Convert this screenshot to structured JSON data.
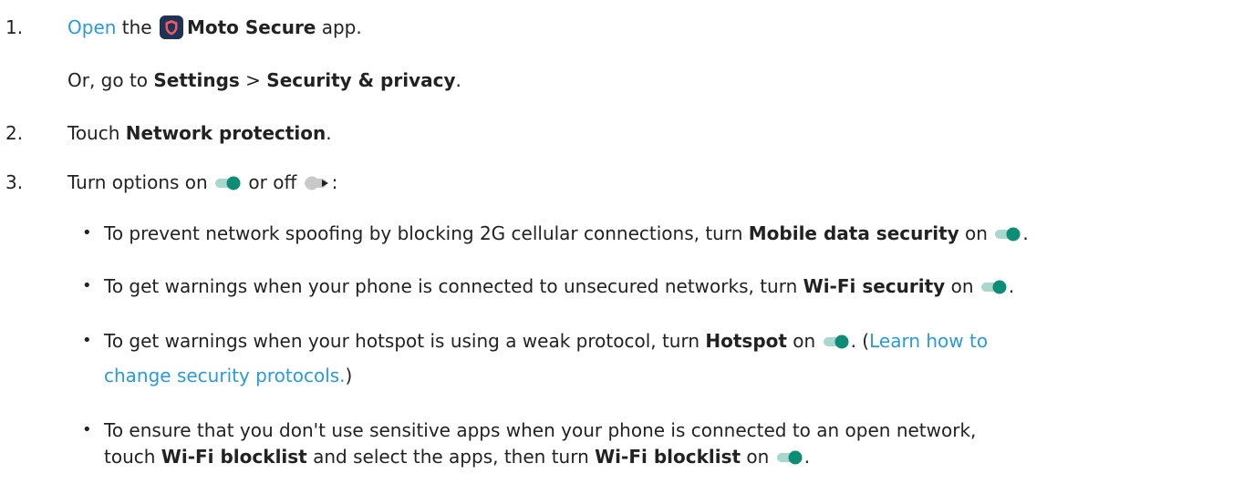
{
  "colors": {
    "link": "#2a9bd8",
    "toggle_on_track": "#a7d7cd",
    "toggle_on_knob": "#0e8c76",
    "toggle_off_track": "#c9c9c9",
    "toggle_off_knob": "#222222",
    "app_icon_bg": "#1d3357",
    "app_icon_shield": "#f05a63"
  },
  "icons": {
    "app": "moto-secure-shield-icon",
    "toggle_on": "toggle-on-icon",
    "toggle_off": "toggle-off-icon"
  },
  "step1": {
    "number": "1.",
    "link_open": "Open",
    "text_the": " the ",
    "app_name": "Moto Secure",
    "text_app": " app.",
    "alt_prefix": "Or, go to ",
    "settings": "Settings",
    "sep": " > ",
    "security_privacy": "Security & privacy",
    "period": "."
  },
  "step2": {
    "number": "2.",
    "prefix": "Touch ",
    "bold": "Network protection",
    "period": "."
  },
  "step3": {
    "number": "3.",
    "text_a": "Turn options on ",
    "text_b": " or off ",
    "colon": ":"
  },
  "bullets": {
    "dot": "•",
    "b1": {
      "prefix": "To prevent network spoofing by blocking 2G cellular connections, turn ",
      "bold": "Mobile data security",
      "on": " on ",
      "period": "."
    },
    "b2": {
      "prefix": "To get warnings when your phone is connected to unsecured networks, turn ",
      "bold": "Wi-Fi security",
      "on": " on ",
      "period": "."
    },
    "b3": {
      "prefix": "To get warnings when your hotspot is using a weak protocol, turn ",
      "bold": "Hotspot",
      "on": " on ",
      "after_toggle": ". (",
      "link_a": "Learn how to",
      "link_b": "change security protocols.",
      "close": ")"
    },
    "b4": {
      "line1": "To ensure that you don't use sensitive apps when your phone is connected to an open network,",
      "touch": "touch ",
      "bold1": "Wi-Fi blocklist",
      "middle": " and select the apps, then turn ",
      "bold2": "Wi-Fi blocklist",
      "on": " on ",
      "period": "."
    }
  }
}
